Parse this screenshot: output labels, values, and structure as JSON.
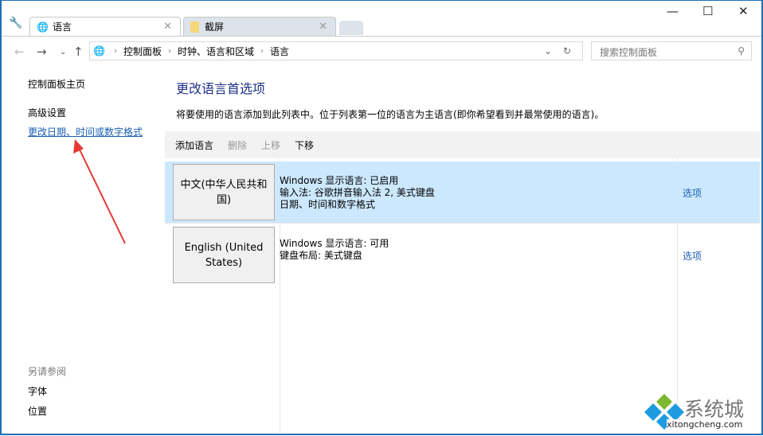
{
  "tabs": [
    {
      "label": "语言",
      "active": true
    },
    {
      "label": "截屏",
      "active": false
    }
  ],
  "address": {
    "crumbs": [
      "控制面板",
      "时钟、语言和区域",
      "语言"
    ],
    "search_placeholder": "搜索控制面板"
  },
  "sidebar": {
    "home": "控制面板主页",
    "items": [
      "高级设置",
      "更改日期、时间或数字格式"
    ],
    "see_also_title": "另请参阅",
    "see_also": [
      "字体",
      "位置"
    ]
  },
  "main": {
    "title": "更改语言首选项",
    "description": "将要使用的语言添加到此列表中。位于列表第一位的语言为主语言(即你希望看到并最常使用的语言)。",
    "toolbar": [
      "添加语言",
      "删除",
      "上移",
      "下移"
    ],
    "languages": [
      {
        "name": "中文(中华人民共和国)",
        "lines": [
          "Windows 显示语言: 已启用",
          "输入法: 谷歌拼音输入法 2, 美式键盘",
          "日期、时间和数字格式"
        ],
        "options": "选项",
        "selected": true
      },
      {
        "name": "English (United States)",
        "lines": [
          "Windows 显示语言: 可用",
          "键盘布局: 美式键盘"
        ],
        "options": "选项",
        "selected": false
      }
    ]
  },
  "watermark": {
    "text": "系统城",
    "url": "xitongcheng.com"
  }
}
